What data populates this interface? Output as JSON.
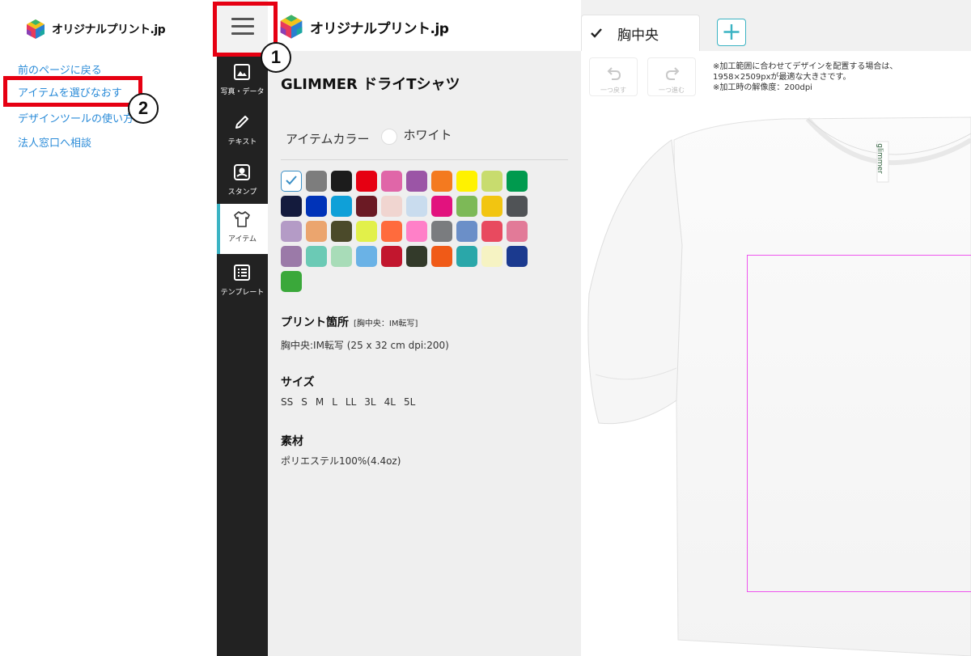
{
  "brand": {
    "name": "オリジナルプリント.jp"
  },
  "left_menu": {
    "items": [
      {
        "label": "前のページに戻る"
      },
      {
        "label": "アイテムを選びなおす"
      },
      {
        "label": "デザインツールの使い方"
      },
      {
        "label": "法人窓口へ相談"
      }
    ]
  },
  "annotations": {
    "step1": "1",
    "step2": "2",
    "accent_color": "#e60012"
  },
  "rail": {
    "items": [
      {
        "label": "写真・データ",
        "icon": "image-icon"
      },
      {
        "label": "テキスト",
        "icon": "pencil-icon"
      },
      {
        "label": "スタンプ",
        "icon": "stamp-icon"
      },
      {
        "label": "アイテム",
        "icon": "tshirt-icon",
        "active": true
      },
      {
        "label": "テンプレート",
        "icon": "list-icon"
      }
    ]
  },
  "product": {
    "name": "GLIMMER ドライTシャツ",
    "color_label": "アイテムカラー",
    "selected_color": "ホワイト",
    "swatches": [
      "#ffffff",
      "#7d7d7d",
      "#1c1c1c",
      "#e60012",
      "#e066a8",
      "#9b55a6",
      "#f47a1f",
      "#fff200",
      "#c8dc6e",
      "#009a4e",
      "#141b3d",
      "#0033b8",
      "#0fa0d8",
      "#6b1a24",
      "#f0d5d0",
      "#c9dcee",
      "#e2127e",
      "#7db957",
      "#f2c511",
      "#505356",
      "#b49bc6",
      "#eba56e",
      "#4b4a2a",
      "#e2f04a",
      "#ff6b3d",
      "#ff80c8",
      "#7a7c7f",
      "#6b8fc8",
      "#e84a5f",
      "#e27a98",
      "#9b7aa8",
      "#6bcab5",
      "#a8dcb8",
      "#6ab2e6",
      "#c2162e",
      "#333a2a",
      "#f05a17",
      "#2aa7a9",
      "#f6f3c3",
      "#1b3a8f",
      "#3aa83a"
    ],
    "print_area_title": "プリント箇所",
    "print_area_tag": "[胸中央：IM転写]",
    "print_area_detail": "胸中央:IM転写 (25 x 32 cm dpi:200)",
    "size_title": "サイズ",
    "sizes": [
      "SS",
      "S",
      "M",
      "L",
      "LL",
      "3L",
      "4L",
      "5L"
    ],
    "material_title": "素材",
    "material": "ポリエステル100%(4.4oz)"
  },
  "canvas": {
    "tab_label": "胸中央",
    "undo_label": "一つ戻す",
    "redo_label": "一つ進む",
    "notice": "※加工範囲に合わせてデザインを配置する場合は、\n1958×2509pxが最適な大きさです。\n※加工時の解像度：200dpi",
    "neck_label": "glimmer",
    "accent_color": "#3bb3c3",
    "print_area_color": "#ee55ee"
  }
}
